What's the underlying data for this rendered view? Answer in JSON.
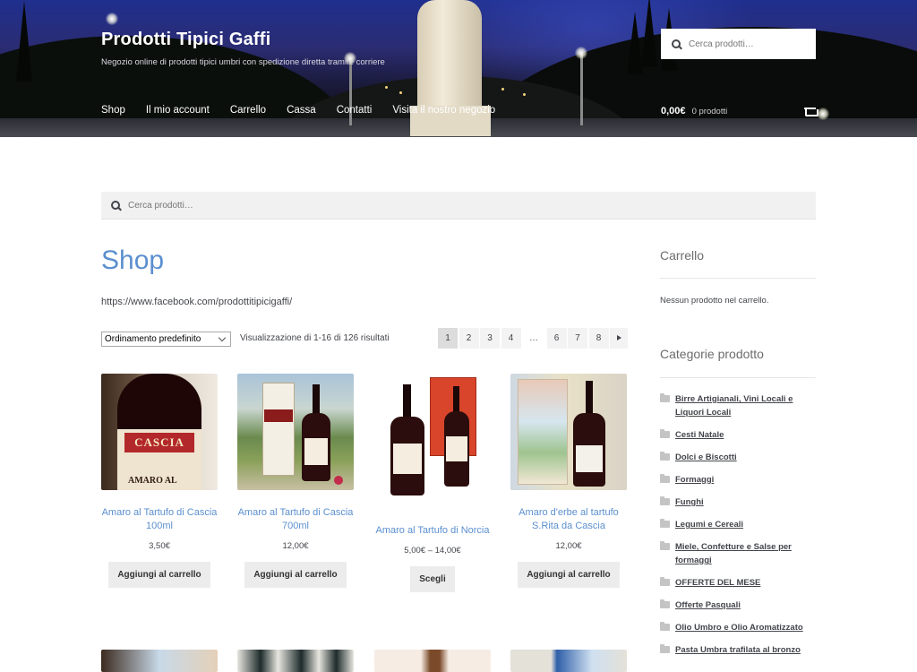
{
  "header": {
    "site_title": "Prodotti Tipici Gaffi",
    "site_description": "Negozio online di prodotti tipici umbri con spedizione diretta tramite corriere",
    "search_placeholder": "Cerca prodotti…",
    "nav": [
      "Shop",
      "Il mio account",
      "Carrello",
      "Cassa",
      "Contatti",
      "Visita il nostro negozio"
    ],
    "cart_amount": "0,00€",
    "cart_count": "0 prodotti"
  },
  "main": {
    "search_placeholder": "Cerca prodotti…",
    "page_title": "Shop",
    "page_description": "https://www.facebook.com/prodottitipicigaffi/",
    "orderby": "Ordinamento predefinito",
    "result_count": "Visualizzazione di 1-16 di 126 risultati",
    "pagination": [
      "1",
      "2",
      "3",
      "4",
      "…",
      "6",
      "7",
      "8"
    ],
    "products": [
      {
        "title": "Amaro al Tartufo di Cascia 100ml",
        "price": "3,50€",
        "button": "Aggiungi al carrello"
      },
      {
        "title": "Amaro al Tartufo di Cascia 700ml",
        "price": "12,00€",
        "button": "Aggiungi al carrello"
      },
      {
        "title": "Amaro al Tartufo di Norcia",
        "price": "5,00€ – 14,00€",
        "button": "Scegli"
      },
      {
        "title": "Amaro d'erbe al tartufo S.Rita da Cascia",
        "price": "12,00€",
        "button": "Aggiungi al carrello"
      }
    ],
    "image_text": {
      "p1_label": "CASCIA",
      "p1_label_bottom": "AMARO AL"
    }
  },
  "sidebar": {
    "cart_title": "Carrello",
    "cart_empty": "Nessun prodotto nel carrello.",
    "categories_title": "Categorie prodotto",
    "categories": [
      "Birre Artigianali, Vini Locali e Liquori Locali",
      "Cesti Natale",
      "Dolci e Biscotti",
      "Formaggi",
      "Funghi",
      "Legumi e Cereali",
      "Miele, Confetture e Salse per formaggi",
      "OFFERTE DEL MESE",
      "Offerte Pasquali",
      "Olio Umbro e Olio Aromatizzato",
      "Pasta Umbra trafilata al bronzo"
    ]
  },
  "colors": {
    "accent": "#5b8fcf",
    "text": "#43454b",
    "button_bg": "#ececec"
  }
}
